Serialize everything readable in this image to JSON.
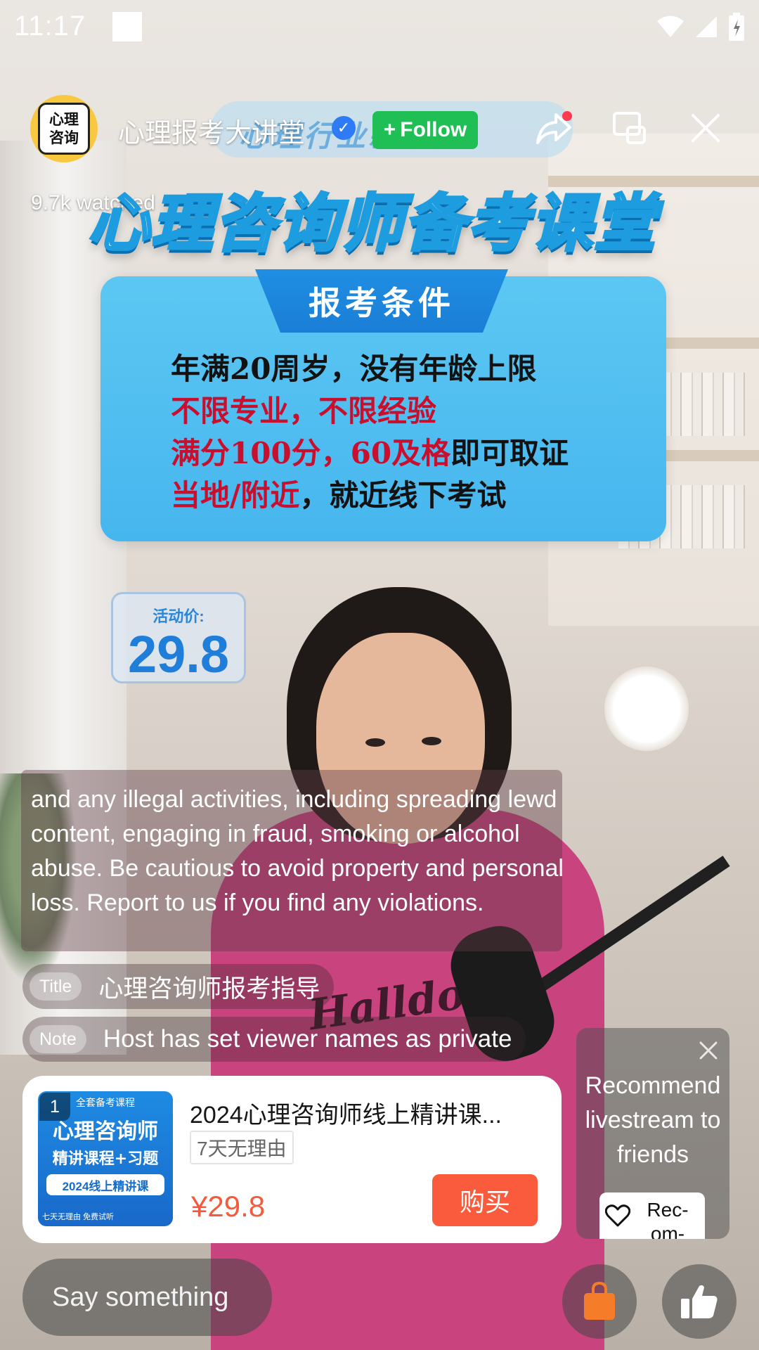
{
  "status_bar": {
    "time": "11:17"
  },
  "header": {
    "avatar_text": [
      "心理",
      "咨询"
    ],
    "host_name": "心理报考大讲堂",
    "follow_label": "Follow",
    "watched": "9.7k watched",
    "pill_background_text": "心理行业新机遇"
  },
  "slide": {
    "banner": "心理咨询师备考课堂",
    "card_title": "报考条件",
    "lines": [
      {
        "parts": [
          {
            "text": "年满20周岁，没有年龄上限",
            "red": false
          }
        ]
      },
      {
        "parts": [
          {
            "text": "不限专业，不限经验",
            "red": true
          }
        ]
      },
      {
        "parts": [
          {
            "text": "满分100分，60及格",
            "red": true
          },
          {
            "text": "即可取证",
            "red": false
          }
        ]
      },
      {
        "parts": [
          {
            "text": "当地/附近",
            "red": true
          },
          {
            "text": "，就近线下考试",
            "red": false
          }
        ]
      }
    ],
    "price_label": "活动价:",
    "price_value": "29.8"
  },
  "chat": {
    "notice": "and any illegal activities, including spreading lewd content, engaging in fraud, smoking or alcohol abuse. Be cautious to avoid property and personal loss. Report to us if you find any violations.",
    "title_tag": "Title",
    "title_text": "心理咨询师报考指导",
    "note_tag": "Note",
    "note_text": "Host has set viewer names as private"
  },
  "product": {
    "rank": "1",
    "image_lines": [
      "全套备考课程",
      "心理咨询师",
      "精讲课程+习题",
      "2024线上精讲课",
      "七天无理由 免费试听"
    ],
    "title": "2024心理咨询师线上精讲课...",
    "tag": "7天无理由",
    "price": "¥29.8",
    "buy_label": "购买"
  },
  "recommend": {
    "text": "Recommend livestream to friends",
    "button_label": "Rec-om-"
  },
  "bottom": {
    "input_placeholder": "Say something"
  },
  "colors": {
    "follow": "#1fbf55",
    "buy": "#fa5b3c",
    "price": "#f45a3c",
    "slide_card": "#46b6ee",
    "verified": "#2f7bf5"
  },
  "icons": [
    "share-icon",
    "screen-mirror-icon",
    "close-icon",
    "verified-icon",
    "heart-icon",
    "shopping-bag-icon",
    "thumbs-up-icon",
    "wifi-icon",
    "signal-icon",
    "battery-icon"
  ]
}
